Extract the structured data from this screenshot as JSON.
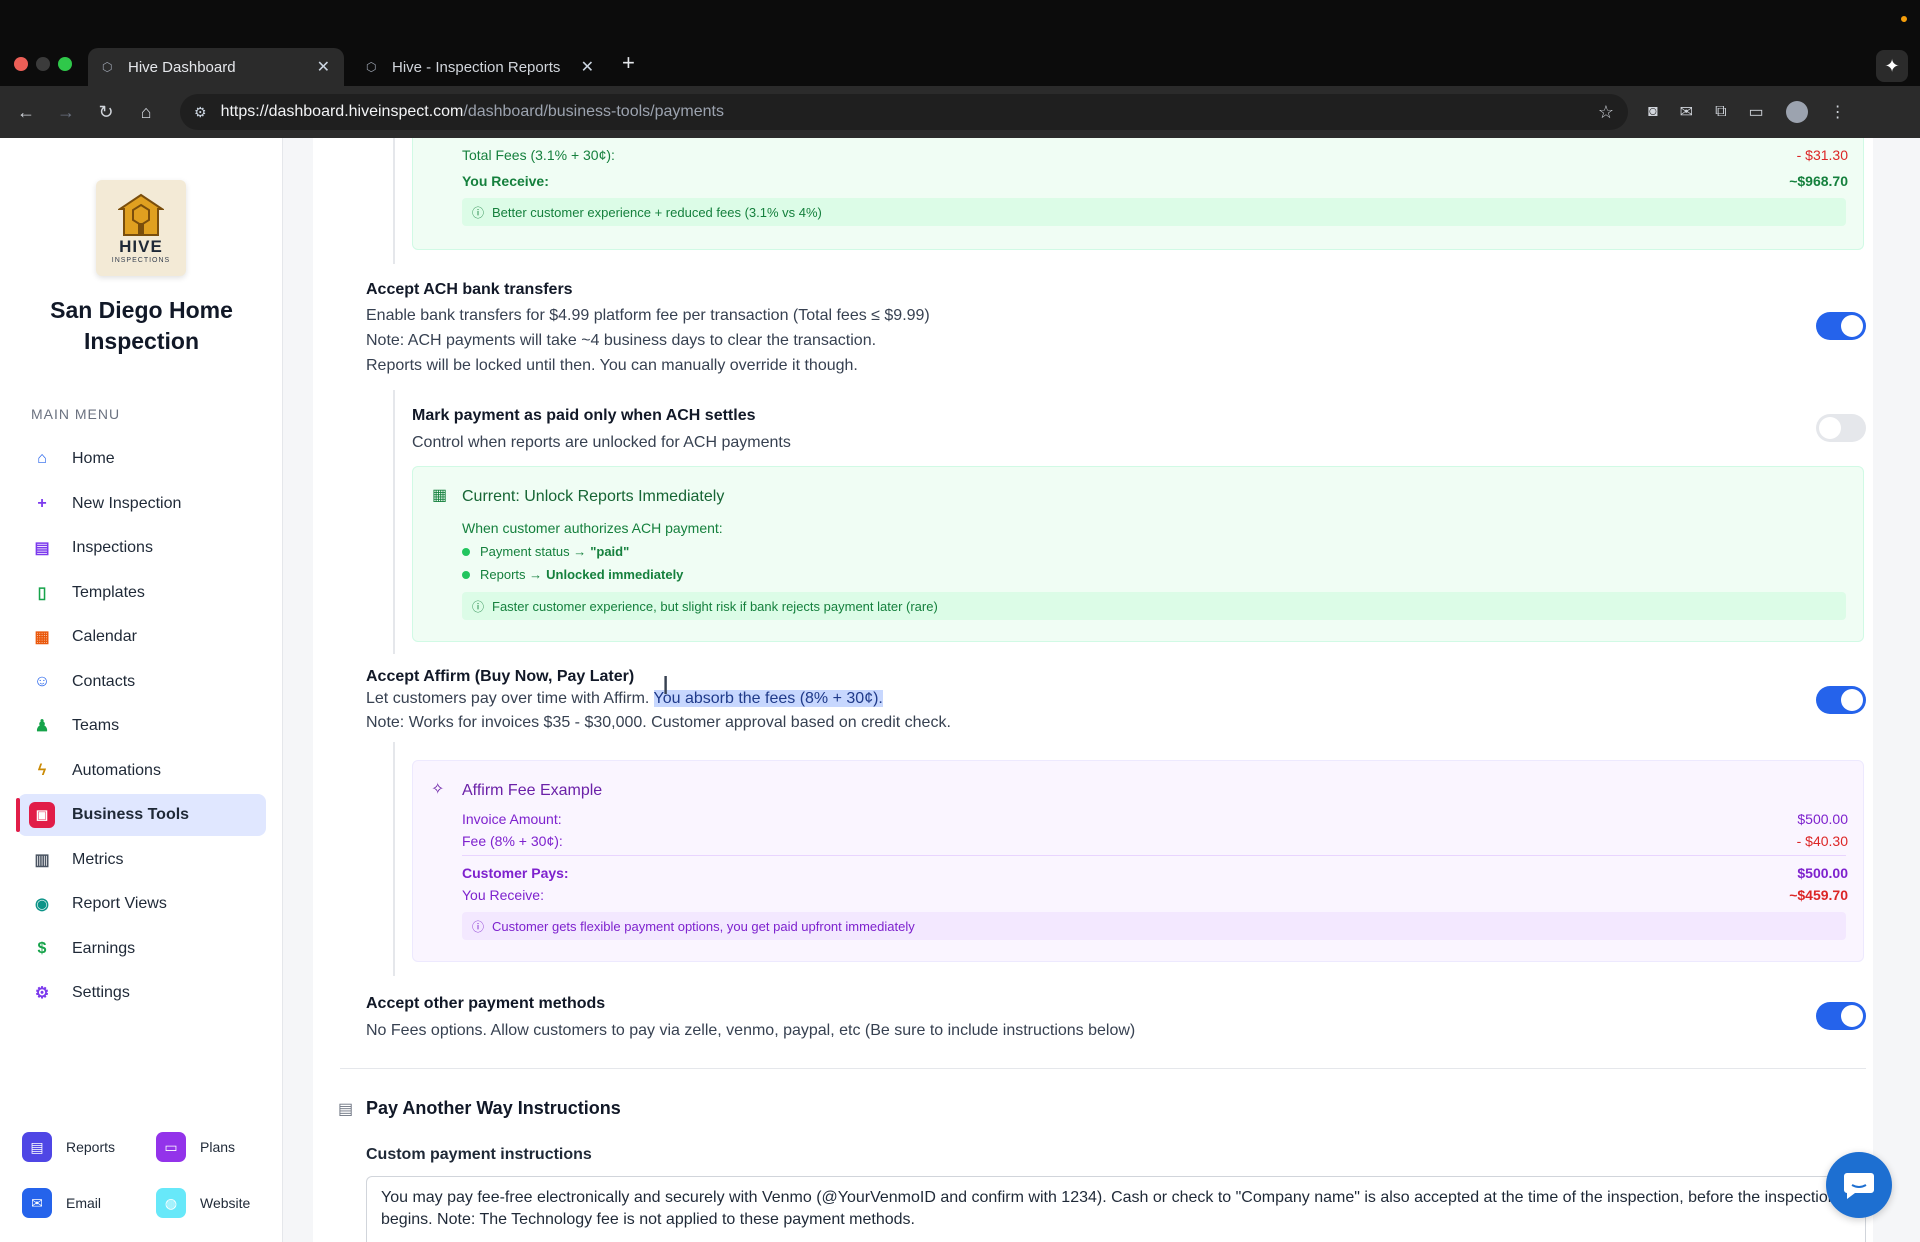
{
  "browser": {
    "tabs": [
      {
        "title": "Hive Dashboard",
        "active": true
      },
      {
        "title": "Hive - Inspection Reports",
        "active": false
      }
    ],
    "url_host": "https://dashboard.hiveinspect.com",
    "url_path": "/dashboard/business-tools/payments"
  },
  "sidebar": {
    "logo_text": "HIVE",
    "logo_sub": "INSPECTIONS",
    "company_name": "San Diego Home Inspection",
    "menu_label": "MAIN MENU",
    "items": [
      {
        "label": "Home",
        "icon": "home-icon",
        "color": "#2563eb"
      },
      {
        "label": "New Inspection",
        "icon": "plus-icon",
        "color": "#7c3aed"
      },
      {
        "label": "Inspections",
        "icon": "clipboard-icon",
        "color": "#7c3aed"
      },
      {
        "label": "Templates",
        "icon": "document-icon",
        "color": "#16a34a"
      },
      {
        "label": "Calendar",
        "icon": "calendar-icon",
        "color": "#ea580c"
      },
      {
        "label": "Contacts",
        "icon": "users-icon",
        "color": "#2563eb"
      },
      {
        "label": "Teams",
        "icon": "team-icon",
        "color": "#16a34a"
      },
      {
        "label": "Automations",
        "icon": "bolt-icon",
        "color": "#ca8a04"
      },
      {
        "label": "Business Tools",
        "icon": "briefcase-icon",
        "color": "#e11d48",
        "active": true
      },
      {
        "label": "Metrics",
        "icon": "bar-chart-icon",
        "color": "#4b5563"
      },
      {
        "label": "Report Views",
        "icon": "eye-icon",
        "color": "#0d9488"
      },
      {
        "label": "Earnings",
        "icon": "dollar-icon",
        "color": "#16a34a"
      },
      {
        "label": "Settings",
        "icon": "gear-icon",
        "color": "#7c3aed"
      }
    ],
    "bottom_links": [
      {
        "label": "Reports",
        "icon": "report-icon",
        "color": "#4f46e5"
      },
      {
        "label": "Plans",
        "icon": "card-icon",
        "color": "#9333ea"
      },
      {
        "label": "Email",
        "icon": "mail-icon",
        "color": "#2563eb"
      },
      {
        "label": "Website",
        "icon": "globe-icon",
        "color": "#22d3ee"
      }
    ]
  },
  "card_top": {
    "total_fees_label": "Total Fees (3.1% + 30¢):",
    "total_fees_value": "- $31.30",
    "you_receive_label": "You Receive:",
    "you_receive_value": "~$968.70",
    "hint": "Better customer experience + reduced fees (3.1% vs 4%)"
  },
  "ach": {
    "title": "Accept ACH bank transfers",
    "line1": "Enable bank transfers for $4.99 platform fee per transaction (Total fees ≤ $9.99)",
    "line2": "Note: ACH payments will take ~4 business days to clear the transaction.",
    "line3": "Reports will be locked until then. You can manually override it though.",
    "enabled": true
  },
  "ach_settle": {
    "title": "Mark payment as paid only when ACH settles",
    "desc": "Control when reports are unlocked for ACH payments",
    "enabled": false,
    "card_title": "Current: Unlock Reports Immediately",
    "card_sub": "When customer authorizes ACH payment:",
    "bullet1_prefix": "Payment status → ",
    "bullet1_value": "\"paid\"",
    "bullet2_prefix": "Reports → ",
    "bullet2_value": "Unlocked immediately",
    "hint": "Faster customer experience, but slight risk if bank rejects payment later (rare)"
  },
  "affirm": {
    "title": "Accept Affirm (Buy Now, Pay Later)",
    "line1_a": "Let customers pay over time with Affirm. ",
    "line1_b": "You absorb the fees (8% + 30¢).",
    "line2": "Note: Works for invoices $35 - $30,000. Customer approval based on credit check.",
    "enabled": true,
    "card_title": "Affirm Fee Example",
    "invoice_label": "Invoice Amount:",
    "invoice_value": "$500.00",
    "fee_label": "Fee (8% + 30¢):",
    "fee_value": "- $40.30",
    "cust_pays_label": "Customer Pays:",
    "cust_pays_value": "$500.00",
    "receive_label": "You Receive:",
    "receive_value": "~$459.70",
    "hint": "Customer gets flexible payment options, you get paid upfront immediately"
  },
  "other": {
    "title": "Accept other payment methods",
    "desc": "No Fees options. Allow customers to pay via zelle, venmo, paypal, etc (Be sure to include instructions below)",
    "enabled": true
  },
  "instructions": {
    "heading": "Pay Another Way Instructions",
    "label": "Custom payment instructions",
    "text": "You may pay fee-free electronically and securely with Venmo (@YourVenmoID and confirm with 1234). Cash or check to \"Company name\" is also accepted at the time of the inspection, before the inspection begins. Note: The Technology fee is not applied to these payment methods."
  }
}
